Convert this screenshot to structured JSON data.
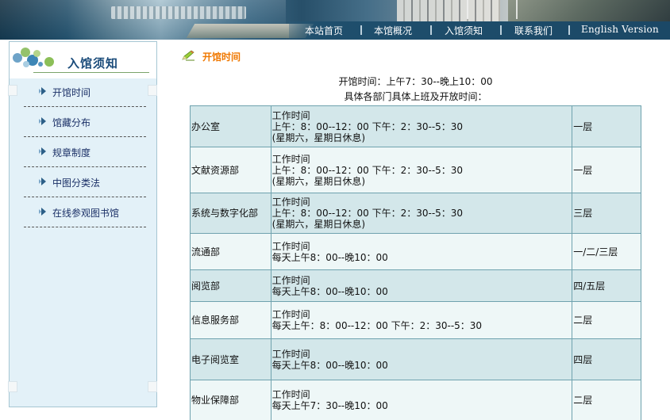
{
  "header": {
    "nav": [
      "本站首页",
      "本馆概况",
      "入馆须知",
      "联系我们",
      "English Version"
    ]
  },
  "sidebar": {
    "title": "入馆须知",
    "items": [
      {
        "label": "开馆时间"
      },
      {
        "label": "馆藏分布"
      },
      {
        "label": "规章制度"
      },
      {
        "label": "中图分类法"
      },
      {
        "label": "在线参观图书馆"
      }
    ]
  },
  "main": {
    "title": "开馆时间",
    "opening_hours": "开馆时间：上午7：30--晚上10：00",
    "subtitle": "具体各部门具体上班及开放时间：",
    "rows": [
      {
        "dept": "办公室",
        "lines": [
          "工作时间",
          "上午：8：00--12：00 下午：2：30--5：30",
          "(星期六，星期日休息)"
        ],
        "floor": "一层"
      },
      {
        "dept": "文献资源部",
        "lines": [
          "工作时间",
          "上午：8：00--12：00 下午：2：30--5：30",
          "(星期六，星期日休息)"
        ],
        "floor": "一层"
      },
      {
        "dept": "系统与数字化部",
        "lines": [
          "工作时间",
          "上午：8：00--12：00 下午：2：30--5：30",
          "(星期六，星期日休息)"
        ],
        "floor": "三层"
      },
      {
        "dept": "流通部",
        "lines": [
          "工作时间",
          "每天上午8：00--晚10：00"
        ],
        "floor": "一/二/三层"
      },
      {
        "dept": "阅览部",
        "lines": [
          "工作时间",
          "每天上午8：00--晚10：00"
        ],
        "floor": "四/五层"
      },
      {
        "dept": "信息服务部",
        "lines": [
          "工作时间",
          "每天上午：8：00--12：00 下午：2：30--5：30"
        ],
        "floor": "二层"
      },
      {
        "dept": "电子阅览室",
        "lines": [
          "工作时间",
          "每天上午8：00--晚10：00"
        ],
        "floor": "四层"
      },
      {
        "dept": "物业保障部",
        "lines": [
          "工作时间",
          "每天上午7：30--晚10：00"
        ],
        "floor": "二层"
      }
    ]
  },
  "icons": {
    "menu_arrow": "arrow-right-icon",
    "title_icon": "pencil-icon",
    "sidebar_logo": "bubbles-logo-icon"
  },
  "colors": {
    "nav_bar": "#1b4866",
    "sidebar_bg": "#e3f1f8",
    "title_orange": "#f07800",
    "table_row_dark": "#d3e7ea",
    "table_row_light": "#eef7f7"
  }
}
